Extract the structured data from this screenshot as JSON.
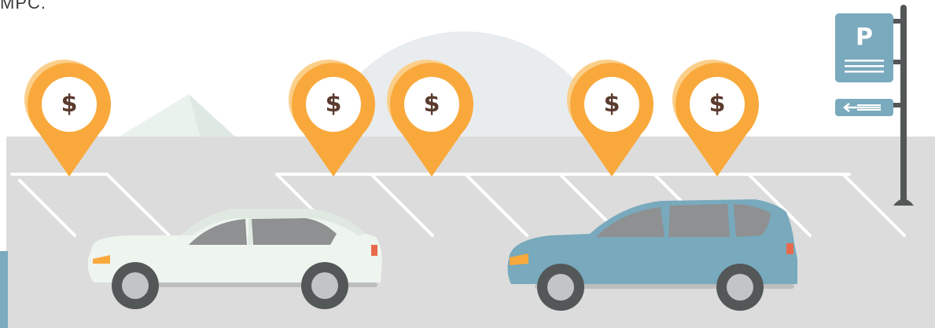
{
  "caption": {
    "text": "MPC."
  },
  "parking_sign": {
    "letter": "P"
  },
  "price_pins": [
    {
      "symbol": "$"
    },
    {
      "symbol": "$"
    },
    {
      "symbol": "$"
    },
    {
      "symbol": "$"
    },
    {
      "symbol": "$"
    }
  ],
  "colors": {
    "pin_orange": "#f9a93c",
    "pin_glyph": "#5a3b2e",
    "lot_gray": "#dcdcdc",
    "sign_blue": "#7aaabd",
    "car_teal": "#78a9bc",
    "car_white": "#eef5ef",
    "pole": "#545758"
  },
  "icons": [
    "price-pin-icon",
    "parking-sign-icon",
    "left-arrow-icon",
    "car-icon"
  ]
}
